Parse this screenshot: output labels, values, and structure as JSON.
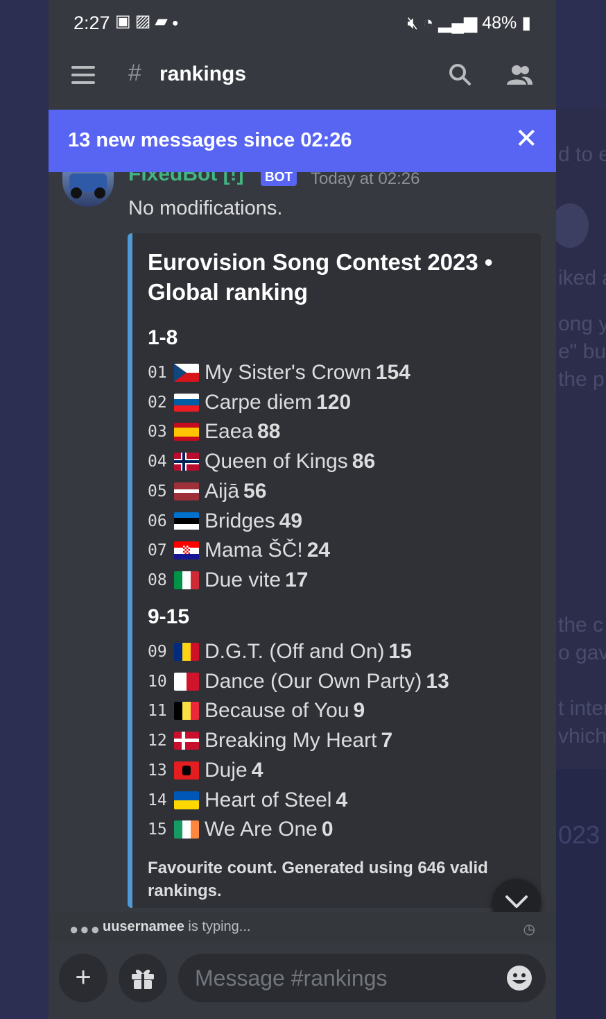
{
  "status_bar": {
    "time": "2:27",
    "left_icons": [
      "twitch-icon",
      "image-icon",
      "chat-icon",
      "dot-icon"
    ],
    "battery": "48%"
  },
  "header": {
    "channel": "rankings"
  },
  "banner": {
    "text": "13 new messages since 02:26"
  },
  "message": {
    "author": "FixedBot [!]",
    "bot_tag": "BOT",
    "timestamp": "Today at 02:26",
    "text": "No modifications."
  },
  "embed": {
    "accent_color": "#4f9ad6",
    "title": "Eurovision Song Contest 2023 • Global ranking",
    "fields": [
      {
        "name": "1-8",
        "rows": [
          {
            "num": "01",
            "flag": "czechia",
            "song": "My Sister's Crown",
            "score": "154"
          },
          {
            "num": "02",
            "flag": "slovenia",
            "song": "Carpe diem",
            "score": "120"
          },
          {
            "num": "03",
            "flag": "spain",
            "song": "Eaea",
            "score": "88"
          },
          {
            "num": "04",
            "flag": "norway",
            "song": "Queen of Kings",
            "score": "86"
          },
          {
            "num": "05",
            "flag": "latvia",
            "song": "Aijā",
            "score": "56"
          },
          {
            "num": "06",
            "flag": "estonia",
            "song": "Bridges",
            "score": "49"
          },
          {
            "num": "07",
            "flag": "croatia",
            "song": "Mama ŠČ!",
            "score": "24"
          },
          {
            "num": "08",
            "flag": "italy",
            "song": "Due vite",
            "score": "17"
          }
        ]
      },
      {
        "name": "9-15",
        "rows": [
          {
            "num": "09",
            "flag": "romania",
            "song": "D.G.T. (Off and On)",
            "score": "15"
          },
          {
            "num": "10",
            "flag": "malta",
            "song": "Dance (Our Own Party)",
            "score": "13"
          },
          {
            "num": "11",
            "flag": "belgium",
            "song": "Because of You",
            "score": "9"
          },
          {
            "num": "12",
            "flag": "denmark",
            "song": "Breaking My Heart",
            "score": "7"
          },
          {
            "num": "13",
            "flag": "albania",
            "song": "Duje",
            "score": "4"
          },
          {
            "num": "14",
            "flag": "ukraine",
            "song": "Heart of Steel",
            "score": "4"
          },
          {
            "num": "15",
            "flag": "ireland",
            "song": "We Are One",
            "score": "0"
          }
        ]
      }
    ],
    "footer": "Favourite count. Generated using 646 valid rankings."
  },
  "typing": {
    "user": "uusernamee",
    "suffix": "is typing..."
  },
  "composer": {
    "placeholder": "Message #rankings"
  },
  "background_ghost_text": [
    "d to e",
    "iked a",
    "ong yo",
    "e\" bu",
    "the p",
    "the c",
    "o gave",
    "t inter",
    "vhich",
    "023"
  ]
}
